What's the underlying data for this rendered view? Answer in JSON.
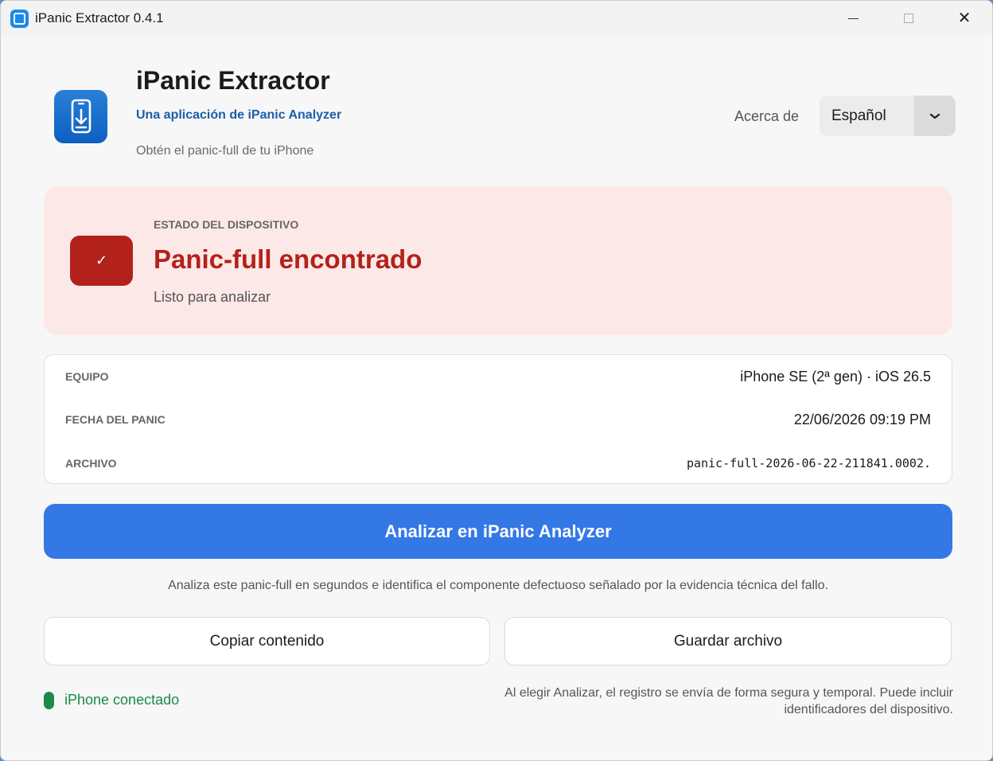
{
  "window": {
    "title": "iPanic Extractor 0.4.1",
    "app_icon": "app-window-icon",
    "controls": [
      "minimize-icon",
      "maximize-icon",
      "close-icon"
    ]
  },
  "header": {
    "logo_icon": "phone-download-icon",
    "title": "iPanic Extractor",
    "subtitle": "Una aplicación de iPanic Analyzer",
    "tagline": "Obtén el panic-full de tu iPhone",
    "about_label": "Acerca de",
    "language": {
      "selected": "Español",
      "caret_icon": "chevron-down-icon"
    }
  },
  "status": {
    "label": "ESTADO DEL DISPOSITIVO",
    "badge_icon": "checkmark-icon",
    "badge_glyph": "✓",
    "title": "Panic-full encontrado",
    "subtitle": "Listo para analizar"
  },
  "details": [
    {
      "key": "EQUIPO",
      "value": "iPhone SE (2ª gen) · iOS 26.5"
    },
    {
      "key": "FECHA DEL PANIC",
      "value": "22/06/2026 09:19 PM"
    },
    {
      "key": "ARCHIVO",
      "value": "panic-full-2026-06-22-211841.0002."
    }
  ],
  "actions": {
    "analyze_label": "Analizar en iPanic Analyzer",
    "analyze_description": "Analiza este panic-full en segundos e identifica el componente defectuoso señalado por la evidencia técnica del fallo.",
    "copy_label": "Copiar contenido",
    "save_label": "Guardar archivo"
  },
  "footer": {
    "connection_status": "iPhone conectado",
    "privacy_note": "Al elegir Analizar, el registro se envía de forma segura y temporal. Puede incluir identificadores del dispositivo."
  },
  "colors": {
    "accent": "#3478e6",
    "brand_blue": "#1a5fa8",
    "status_red": "#b2221b",
    "status_bg": "#fde8e8",
    "connected_green": "#1a8a48"
  }
}
